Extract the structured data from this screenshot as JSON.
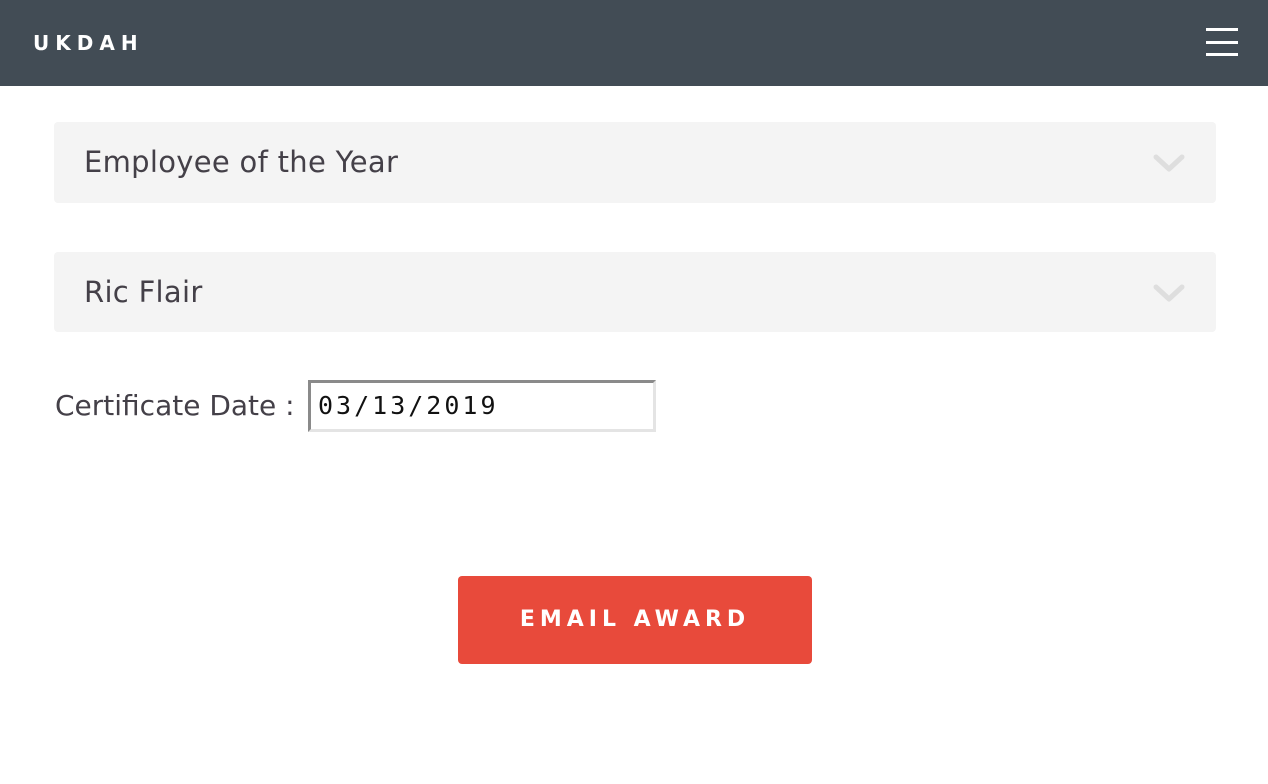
{
  "navbar": {
    "brand": "UKDAH",
    "menu_icon": "hamburger-menu-icon"
  },
  "form": {
    "award_select": {
      "value": "Employee of the Year",
      "icon": "chevron-down-icon"
    },
    "recipient_select": {
      "value": "Ric Flair",
      "icon": "chevron-down-icon"
    },
    "certificate_date": {
      "label": "Certificate Date :",
      "value": "03/13/2019"
    },
    "submit_label": "EMAIL AWARD"
  },
  "colors": {
    "navbar_bg": "#424c55",
    "button_bg": "#e84a3b",
    "select_bg": "#f4f4f4",
    "text": "#444048"
  }
}
